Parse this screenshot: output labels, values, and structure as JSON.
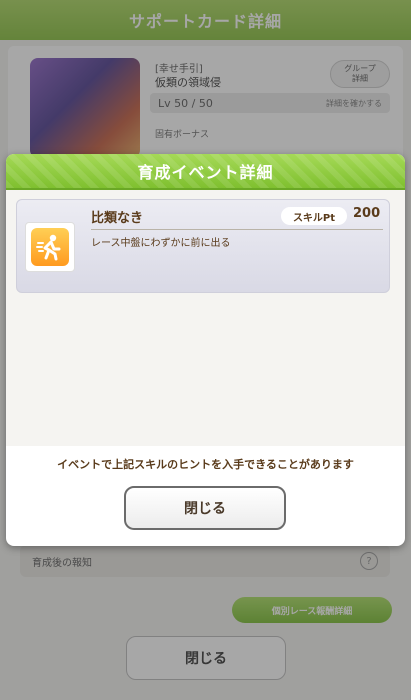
{
  "background": {
    "header_title": "サポートカード詳細",
    "card_title": "[幸せ手引]",
    "card_name": "仮類の領域侵",
    "group_button": "グループ\n詳細",
    "level": "Lv 50 / 50",
    "level_right": "詳細を確かする",
    "bonus_label": "固有ボーナス",
    "hint_row_text": "育成後の報知",
    "hint_q": "?",
    "green_button": "個別レース報酬詳細",
    "close_button": "閉じる"
  },
  "modal": {
    "title": "育成イベント詳細",
    "skill": {
      "name": "比類なき",
      "pt_label": "スキルPt",
      "pt_value": "200",
      "description": "レース中盤にわずかに前に出る",
      "icon": "speed-up-runner-icon",
      "icon_color": "#ff9a1f"
    },
    "note": "イベントで上記スキルのヒントを入手できることがあります",
    "close_button": "閉じる"
  },
  "colors": {
    "header_green": "#86bf3a",
    "text_brown": "#5a3b1b"
  }
}
